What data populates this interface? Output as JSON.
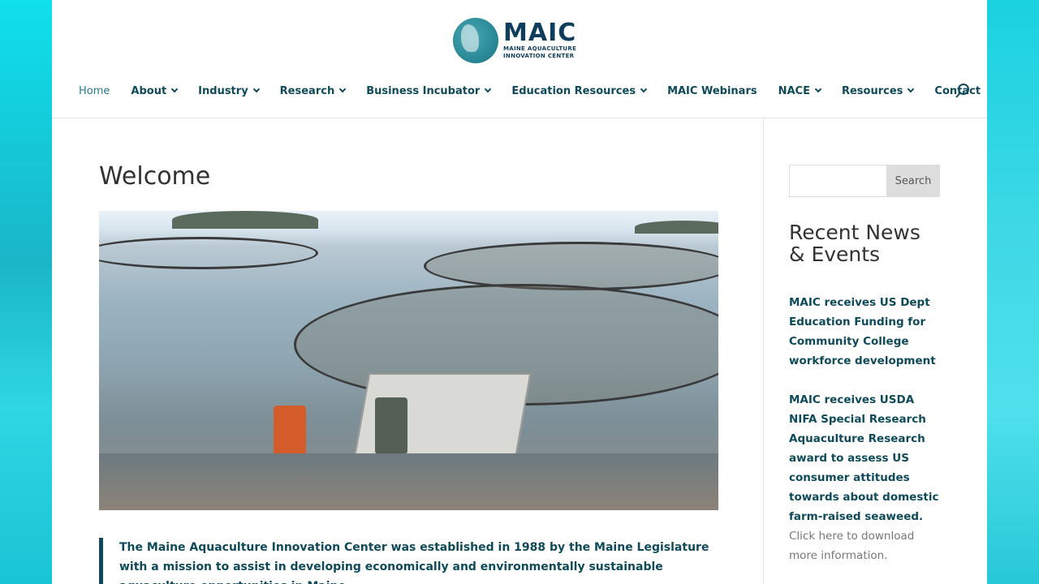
{
  "site": {
    "logo_big": "MAIC",
    "logo_line1": "MAINE AQUACULTURE",
    "logo_line2": "INNOVATION CENTER"
  },
  "nav": {
    "items": [
      {
        "label": "Home",
        "has_dropdown": false,
        "active": true
      },
      {
        "label": "About",
        "has_dropdown": true
      },
      {
        "label": "Industry",
        "has_dropdown": true
      },
      {
        "label": "Research",
        "has_dropdown": true
      },
      {
        "label": "Business Incubator",
        "has_dropdown": true
      },
      {
        "label": "Education Resources",
        "has_dropdown": true
      },
      {
        "label": "MAIC Webinars",
        "has_dropdown": false
      },
      {
        "label": "NACE",
        "has_dropdown": true
      },
      {
        "label": "Resources",
        "has_dropdown": true
      },
      {
        "label": "Contact",
        "has_dropdown": false
      }
    ],
    "search_icon": "search-icon"
  },
  "main": {
    "title": "Welcome",
    "intro": "The Maine Aquaculture Innovation Center was established in 1988 by the Maine Legislature with a mission to assist in developing economically and environmentally sustainable aquaculture opportunities in Maine."
  },
  "sidebar": {
    "search_placeholder": "",
    "search_value": "",
    "search_button": "Search",
    "widget_title": "Recent News & Events",
    "news": [
      {
        "link": "MAIC receives US Dept Education Funding for Community College workforce development",
        "after": ""
      },
      {
        "link": "MAIC receives USDA NIFA Special Research Aquaculture Research award to assess US consumer attitudes towards about domestic farm-raised seaweed.",
        "after": " Click here to download more information."
      }
    ]
  },
  "colors": {
    "accent": "#0e4a5a",
    "background": "#2ec6d6"
  }
}
